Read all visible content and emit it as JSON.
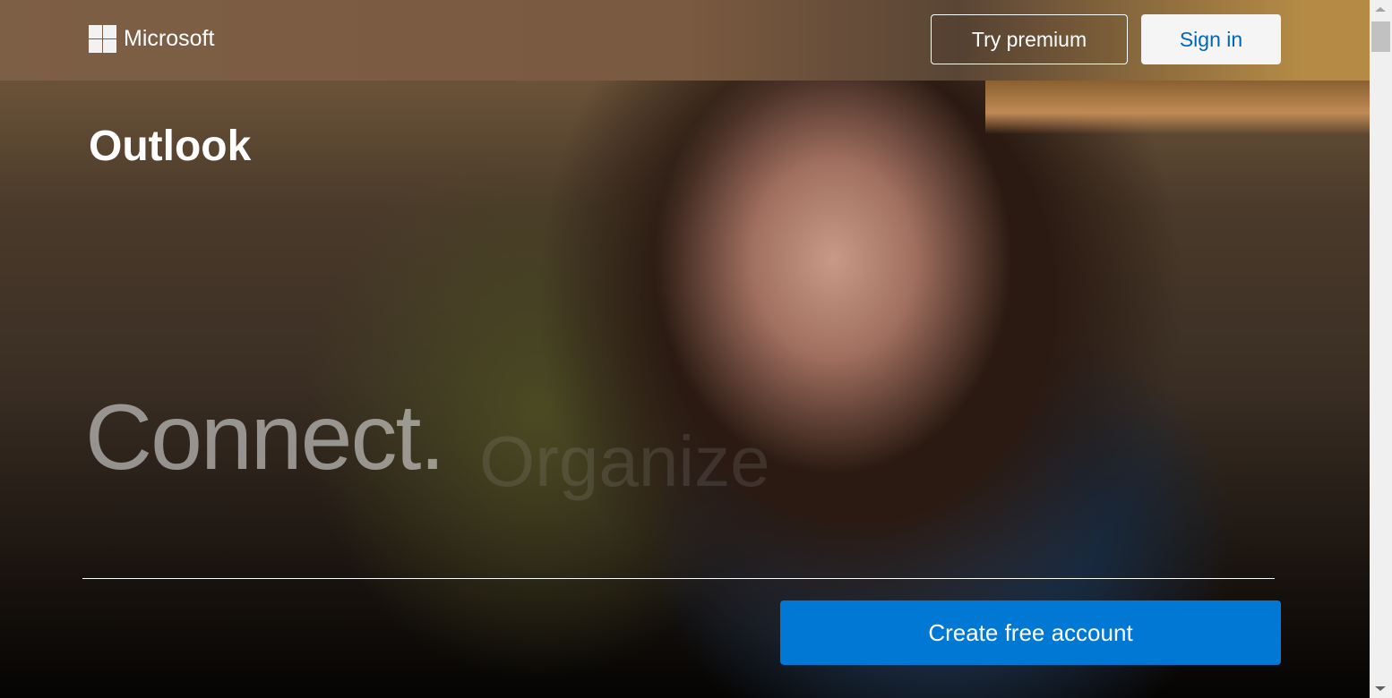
{
  "header": {
    "brand": "Microsoft",
    "try_premium": "Try premium",
    "sign_in": "Sign in"
  },
  "hero": {
    "title": "Outlook",
    "headline": "Connect.",
    "next_word": "Organize",
    "cta": "Create free account"
  },
  "colors": {
    "accent": "#0078d4",
    "signin_text": "#0067b8"
  }
}
